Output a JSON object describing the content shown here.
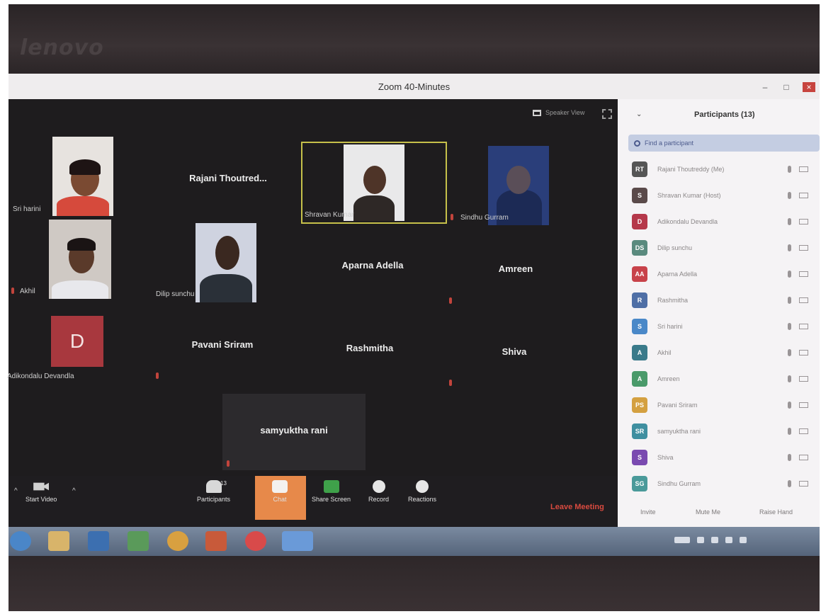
{
  "window": {
    "title": "Zoom 40-Minutes",
    "controls": [
      "–",
      "□",
      "×"
    ]
  },
  "stage": {
    "view_toggle_label": "Speaker View",
    "tiles": [
      {
        "name": "Sri harini",
        "kind": "video"
      },
      {
        "name": "Rajani  Thoutred...",
        "kind": "name-only"
      },
      {
        "name": "Shravan Kumar",
        "kind": "video",
        "active_speaker": true
      },
      {
        "name": "Sindhu Gurram",
        "kind": "video"
      },
      {
        "name": "Akhil",
        "kind": "video"
      },
      {
        "name": "Dilip sunchu",
        "kind": "video"
      },
      {
        "name": "Aparna Adella",
        "kind": "name-only"
      },
      {
        "name": "Amreen",
        "kind": "name-only"
      },
      {
        "name": "Adikondalu Devandla",
        "kind": "avatar",
        "avatar_letter": "D"
      },
      {
        "name": "Pavani Sriram",
        "kind": "name-only"
      },
      {
        "name": "Rashmitha",
        "kind": "name-only"
      },
      {
        "name": "Shiva",
        "kind": "name-only"
      },
      {
        "name": "samyuktha rani",
        "kind": "name-only"
      }
    ]
  },
  "toolbar": {
    "start_video": "Start Video",
    "participants": "Participants",
    "participants_count": "13",
    "chat": "Chat",
    "share_screen": "Share Screen",
    "record": "Record",
    "reactions": "Reactions",
    "leave": "Leave Meeting"
  },
  "panel": {
    "title": "Participants (13)",
    "search_placeholder": "Find a participant",
    "participants": [
      {
        "initials": "RT",
        "name": "Rajani Thoutreddy (Me)",
        "color": "#555555"
      },
      {
        "initials": "S",
        "name": "Shravan Kumar (Host)",
        "color": "#5a4a4a"
      },
      {
        "initials": "D",
        "name": "Adikondalu Devandla",
        "color": "#b5384a"
      },
      {
        "initials": "DS",
        "name": "Dilip sunchu",
        "color": "#5a8a7e"
      },
      {
        "initials": "AA",
        "name": "Aparna Adella",
        "color": "#c8424a"
      },
      {
        "initials": "R",
        "name": "Rashmitha",
        "color": "#4f6fa6"
      },
      {
        "initials": "S",
        "name": "Sri harini",
        "color": "#4a88c8"
      },
      {
        "initials": "A",
        "name": "Akhil",
        "color": "#3a7a8a"
      },
      {
        "initials": "A",
        "name": "Amreen",
        "color": "#4a9a6a"
      },
      {
        "initials": "PS",
        "name": "Pavani Sriram",
        "color": "#d4a040"
      },
      {
        "initials": "SR",
        "name": "samyuktha rani",
        "color": "#3f8fa0"
      },
      {
        "initials": "S",
        "name": "Shiva",
        "color": "#7a4ab0"
      },
      {
        "initials": "SG",
        "name": "Sindhu Gurram",
        "color": "#4a9a9a"
      }
    ],
    "footer": {
      "invite": "Invite",
      "mute_me": "Mute Me",
      "raise_hand": "Raise Hand"
    }
  },
  "bezel": {
    "brand": "lenovo"
  },
  "taskbar": {
    "apps": [
      "internet-explorer-icon",
      "file-explorer-icon",
      "computer-icon",
      "store-icon",
      "chrome-icon",
      "powerpoint-icon",
      "mail-icon",
      "zoom-icon"
    ]
  }
}
